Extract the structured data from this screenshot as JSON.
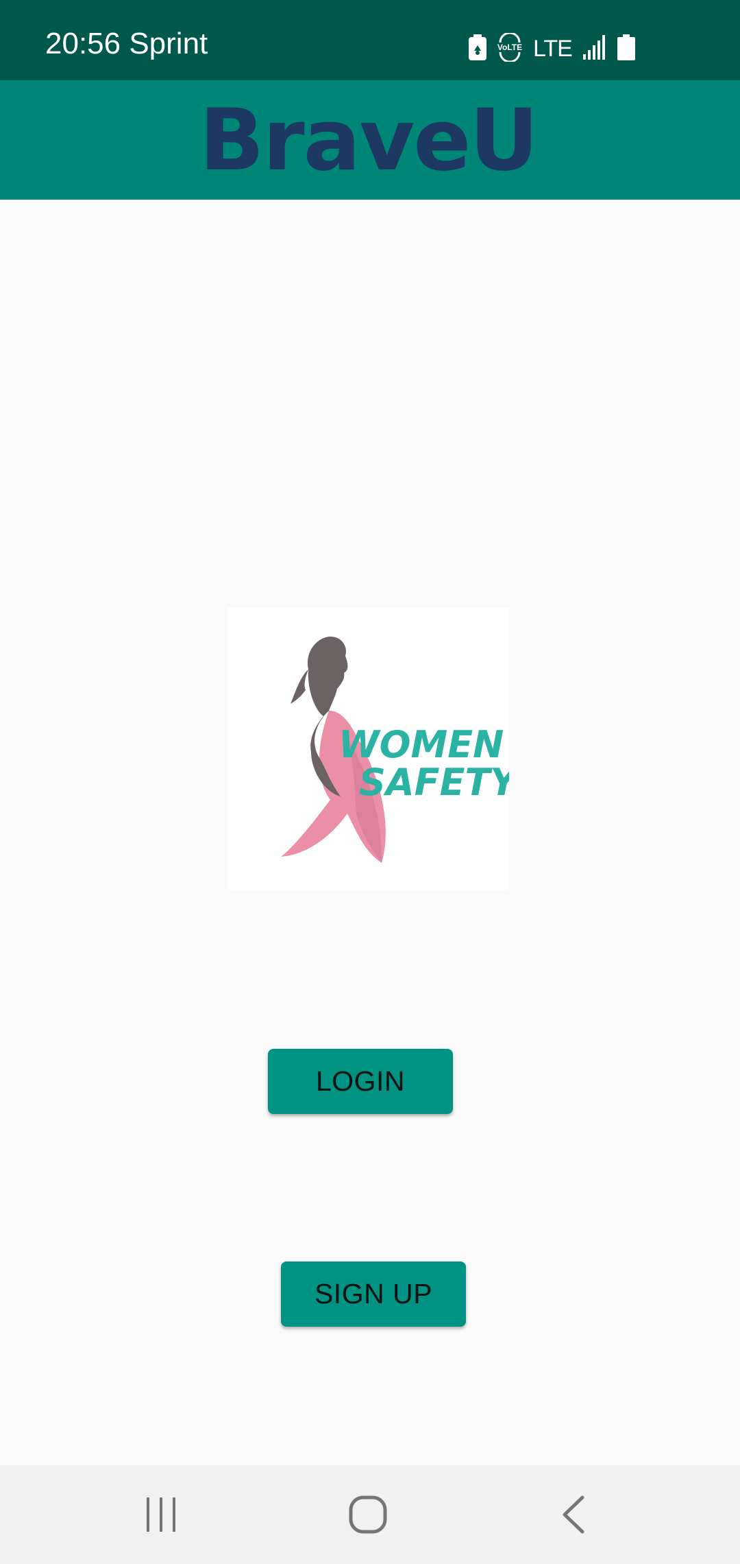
{
  "status_bar": {
    "time_carrier": "20:56 Sprint",
    "volte_label": "VoLTE",
    "network_label": "LTE",
    "icons": [
      "battery-saver-icon",
      "volte-icon",
      "lte-icon",
      "signal-icon",
      "battery-icon"
    ]
  },
  "app_bar": {
    "title": "BraveU"
  },
  "logo": {
    "line1": "WOMEN",
    "line2": "SAFETY",
    "icon": "woman-silhouette-icon"
  },
  "buttons": {
    "login_label": "LOGIN",
    "signup_label": "SIGN UP"
  },
  "nav_bar": {
    "icons": [
      "recent-apps-icon",
      "home-icon",
      "back-icon"
    ]
  },
  "colors": {
    "status_bar": "#00584c",
    "app_bar": "#008677",
    "title": "#1d3961",
    "button": "#009384",
    "background": "#fafafa",
    "logo_pink": "#ea8fa6",
    "logo_grey": "#6b6264",
    "logo_teal": "#2ab3a4"
  }
}
